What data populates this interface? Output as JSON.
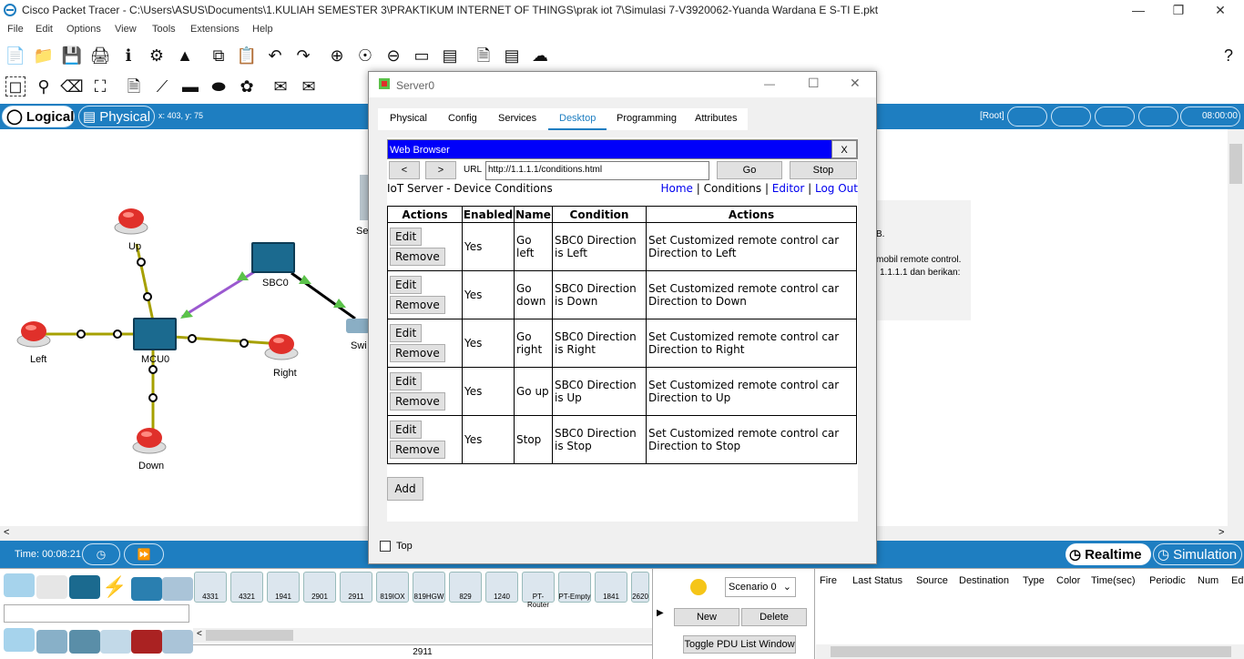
{
  "window": {
    "title": "Cisco Packet Tracer - C:\\Users\\ASUS\\Documents\\1.KULIAH SEMESTER 3\\PRAKTIKUM INTERNET OF THINGS\\prak iot 7\\Simulasi 7-V3920062-Yuanda Wardana E S-TI E.pkt"
  },
  "menu": [
    "File",
    "Edit",
    "Options",
    "View",
    "Tools",
    "Extensions",
    "Help"
  ],
  "mode": {
    "logical": "Logical",
    "physical": "Physical",
    "coords": "x: 403, y: 75",
    "root": "[Root]",
    "clock": "08:00:00"
  },
  "workspace": {
    "labels": {
      "up": "Up",
      "left": "Left",
      "down": "Down",
      "right": "Right",
      "mcu": "MCU0",
      "sbc": "SBC0",
      "sw": "Swi",
      "se": "Se"
    },
    "side_text": [
      "B.",
      "mobil remote control.",
      "1.1.1.1 dan berikan:"
    ]
  },
  "timebar": {
    "time": "Time: 00:08:21",
    "realtime": "Realtime",
    "simulation": "Simulation"
  },
  "devices": [
    "4331",
    "4321",
    "1941",
    "2901",
    "2911",
    "819IOX",
    "819HGW",
    "829",
    "1240",
    "PT-Router",
    "PT-Empty",
    "1841",
    "2620"
  ],
  "selected_device": "2911",
  "scenario": {
    "select": "Scenario 0",
    "new": "New",
    "delete": "Delete",
    "toggle": "Toggle PDU List Window"
  },
  "pdu_columns": [
    "Fire",
    "Last Status",
    "Source",
    "Destination",
    "Type",
    "Color",
    "Time(sec)",
    "Periodic",
    "Num",
    "Ed"
  ],
  "dialog": {
    "title": "Server0",
    "tabs": [
      "Physical",
      "Config",
      "Services",
      "Desktop",
      "Programming",
      "Attributes"
    ],
    "top_label": "Top",
    "browser": {
      "title": "Web Browser",
      "close": "X",
      "back": "<",
      "forward": ">",
      "url_label": "URL",
      "url": "http://1.1.1.1/conditions.html",
      "go": "Go",
      "stop": "Stop",
      "heading": "IoT Server - Device Conditions",
      "links": {
        "home": "Home",
        "conditions": "Conditions",
        "editor": "Editor",
        "logout": "Log Out"
      },
      "columns": [
        "Actions",
        "Enabled",
        "Name",
        "Condition",
        "Actions"
      ],
      "edit": "Edit",
      "remove": "Remove",
      "add": "Add",
      "rows": [
        {
          "enabled": "Yes",
          "name": "Go left",
          "condition": "SBC0 Direction is Left",
          "action": "Set Customized remote control car Direction to Left"
        },
        {
          "enabled": "Yes",
          "name": "Go down",
          "condition": "SBC0 Direction is Down",
          "action": "Set Customized remote control car Direction to Down"
        },
        {
          "enabled": "Yes",
          "name": "Go right",
          "condition": "SBC0 Direction is Right",
          "action": "Set Customized remote control car Direction to Right"
        },
        {
          "enabled": "Yes",
          "name": "Go up",
          "condition": "SBC0 Direction is Up",
          "action": "Set Customized remote control car Direction to Up"
        },
        {
          "enabled": "Yes",
          "name": "Stop",
          "condition": "SBC0 Direction is Stop",
          "action": "Set Customized remote control car Direction to Stop"
        }
      ]
    }
  }
}
